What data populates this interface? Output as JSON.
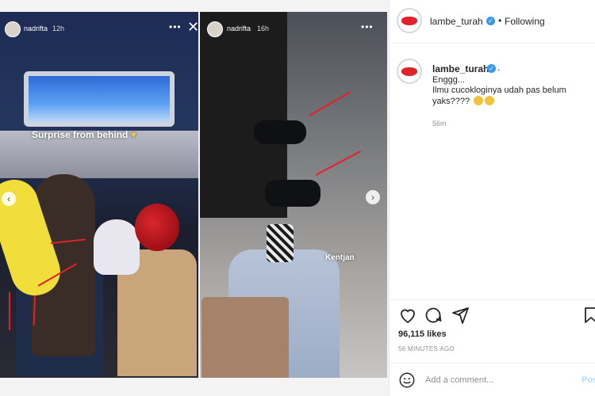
{
  "left_story": {
    "username": "nadrifta",
    "time": "12h",
    "menu_icon": "more-horizontal-icon",
    "close_icon": "close-icon",
    "caption": "Surprise from behind"
  },
  "right_story": {
    "username": "nadrifta",
    "time": "16h",
    "menu_icon": "more-horizontal-icon",
    "caption": "Kentjan"
  },
  "post": {
    "account": "lambe_turah",
    "follow_status": "Following",
    "comment_author": "lambe_turah",
    "comment_line1": "Enggg...",
    "comment_line2": "Ilmu cucokloginya udah pas belum",
    "comment_line3": "yaks????",
    "comment_age": "56m",
    "likes": "96,115 likes",
    "posted": "56 MINUTES AGO",
    "comment_placeholder": "Add a comment...",
    "post_label": "Post"
  },
  "colors": {
    "accent_red": "#e0222b",
    "verified_blue": "#3897f0",
    "post_button": "#b2dffc"
  }
}
